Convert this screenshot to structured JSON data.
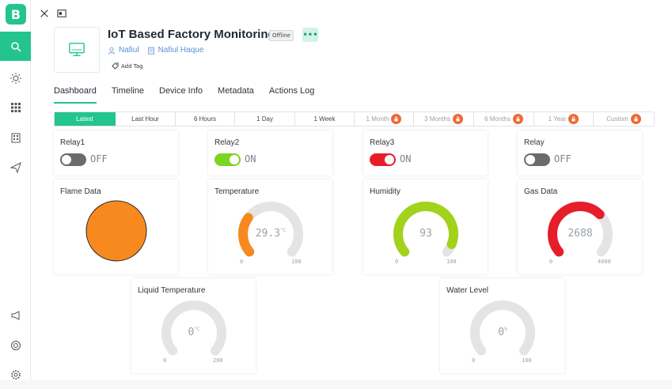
{
  "sidebar": {
    "logo": "B",
    "icons": [
      "search-icon",
      "sun-icon",
      "grid-icon",
      "building-icon",
      "send-icon",
      "megaphone-icon",
      "lifebuoy-icon",
      "settings-icon"
    ]
  },
  "device": {
    "title": "IoT Based Factory Monitoring",
    "status": "Offline",
    "more": "•••",
    "owner": "Nafiul",
    "organization": "Nafiul Haque",
    "add_tag": "Add Tag"
  },
  "tabs": [
    "Dashboard",
    "Timeline",
    "Device Info",
    "Metadata",
    "Actions Log"
  ],
  "ranges": [
    {
      "label": "Latest",
      "locked": false
    },
    {
      "label": "Last Hour",
      "locked": false
    },
    {
      "label": "6 Hours",
      "locked": false
    },
    {
      "label": "1 Day",
      "locked": false
    },
    {
      "label": "1 Week",
      "locked": false
    },
    {
      "label": "1 Month",
      "locked": true
    },
    {
      "label": "3 Months",
      "locked": true
    },
    {
      "label": "6 Months",
      "locked": true
    },
    {
      "label": "1 Year",
      "locked": true
    },
    {
      "label": "Custom",
      "locked": true
    }
  ],
  "switches": [
    {
      "title": "Relay1",
      "state": "OFF",
      "on": false,
      "color": "#6b6b6b"
    },
    {
      "title": "Relay2",
      "state": "ON",
      "on": true,
      "color": "#7ed321"
    },
    {
      "title": "Relay3",
      "state": "ON",
      "on": true,
      "color": "#e61e2a"
    },
    {
      "title": "Relay",
      "state": "OFF",
      "on": false,
      "color": "#6b6b6b"
    }
  ],
  "flame": {
    "title": "Flame Data",
    "color": "#f7891f"
  },
  "gauges": {
    "temperature": {
      "title": "Temperature",
      "value": "29.3",
      "unit": "°C",
      "min": "0",
      "max": "100",
      "fraction": 0.293,
      "color": "#f7891f"
    },
    "humidity": {
      "title": "Humidity",
      "value": "93",
      "unit": "",
      "min": "0",
      "max": "100",
      "fraction": 0.93,
      "color": "#a2d21b"
    },
    "gas": {
      "title": "Gas Data",
      "value": "2688",
      "unit": "",
      "min": "0",
      "max": "4000",
      "fraction": 0.672,
      "color": "#e61e2a"
    },
    "liquid": {
      "title": "Liquid Temperature",
      "value": "0",
      "unit": "°C",
      "min": "0",
      "max": "200",
      "fraction": 0,
      "color": "#cccccc"
    },
    "water": {
      "title": "Water Level",
      "value": "0",
      "unit": "%",
      "min": "0",
      "max": "100",
      "fraction": 0,
      "color": "#cccccc"
    }
  }
}
